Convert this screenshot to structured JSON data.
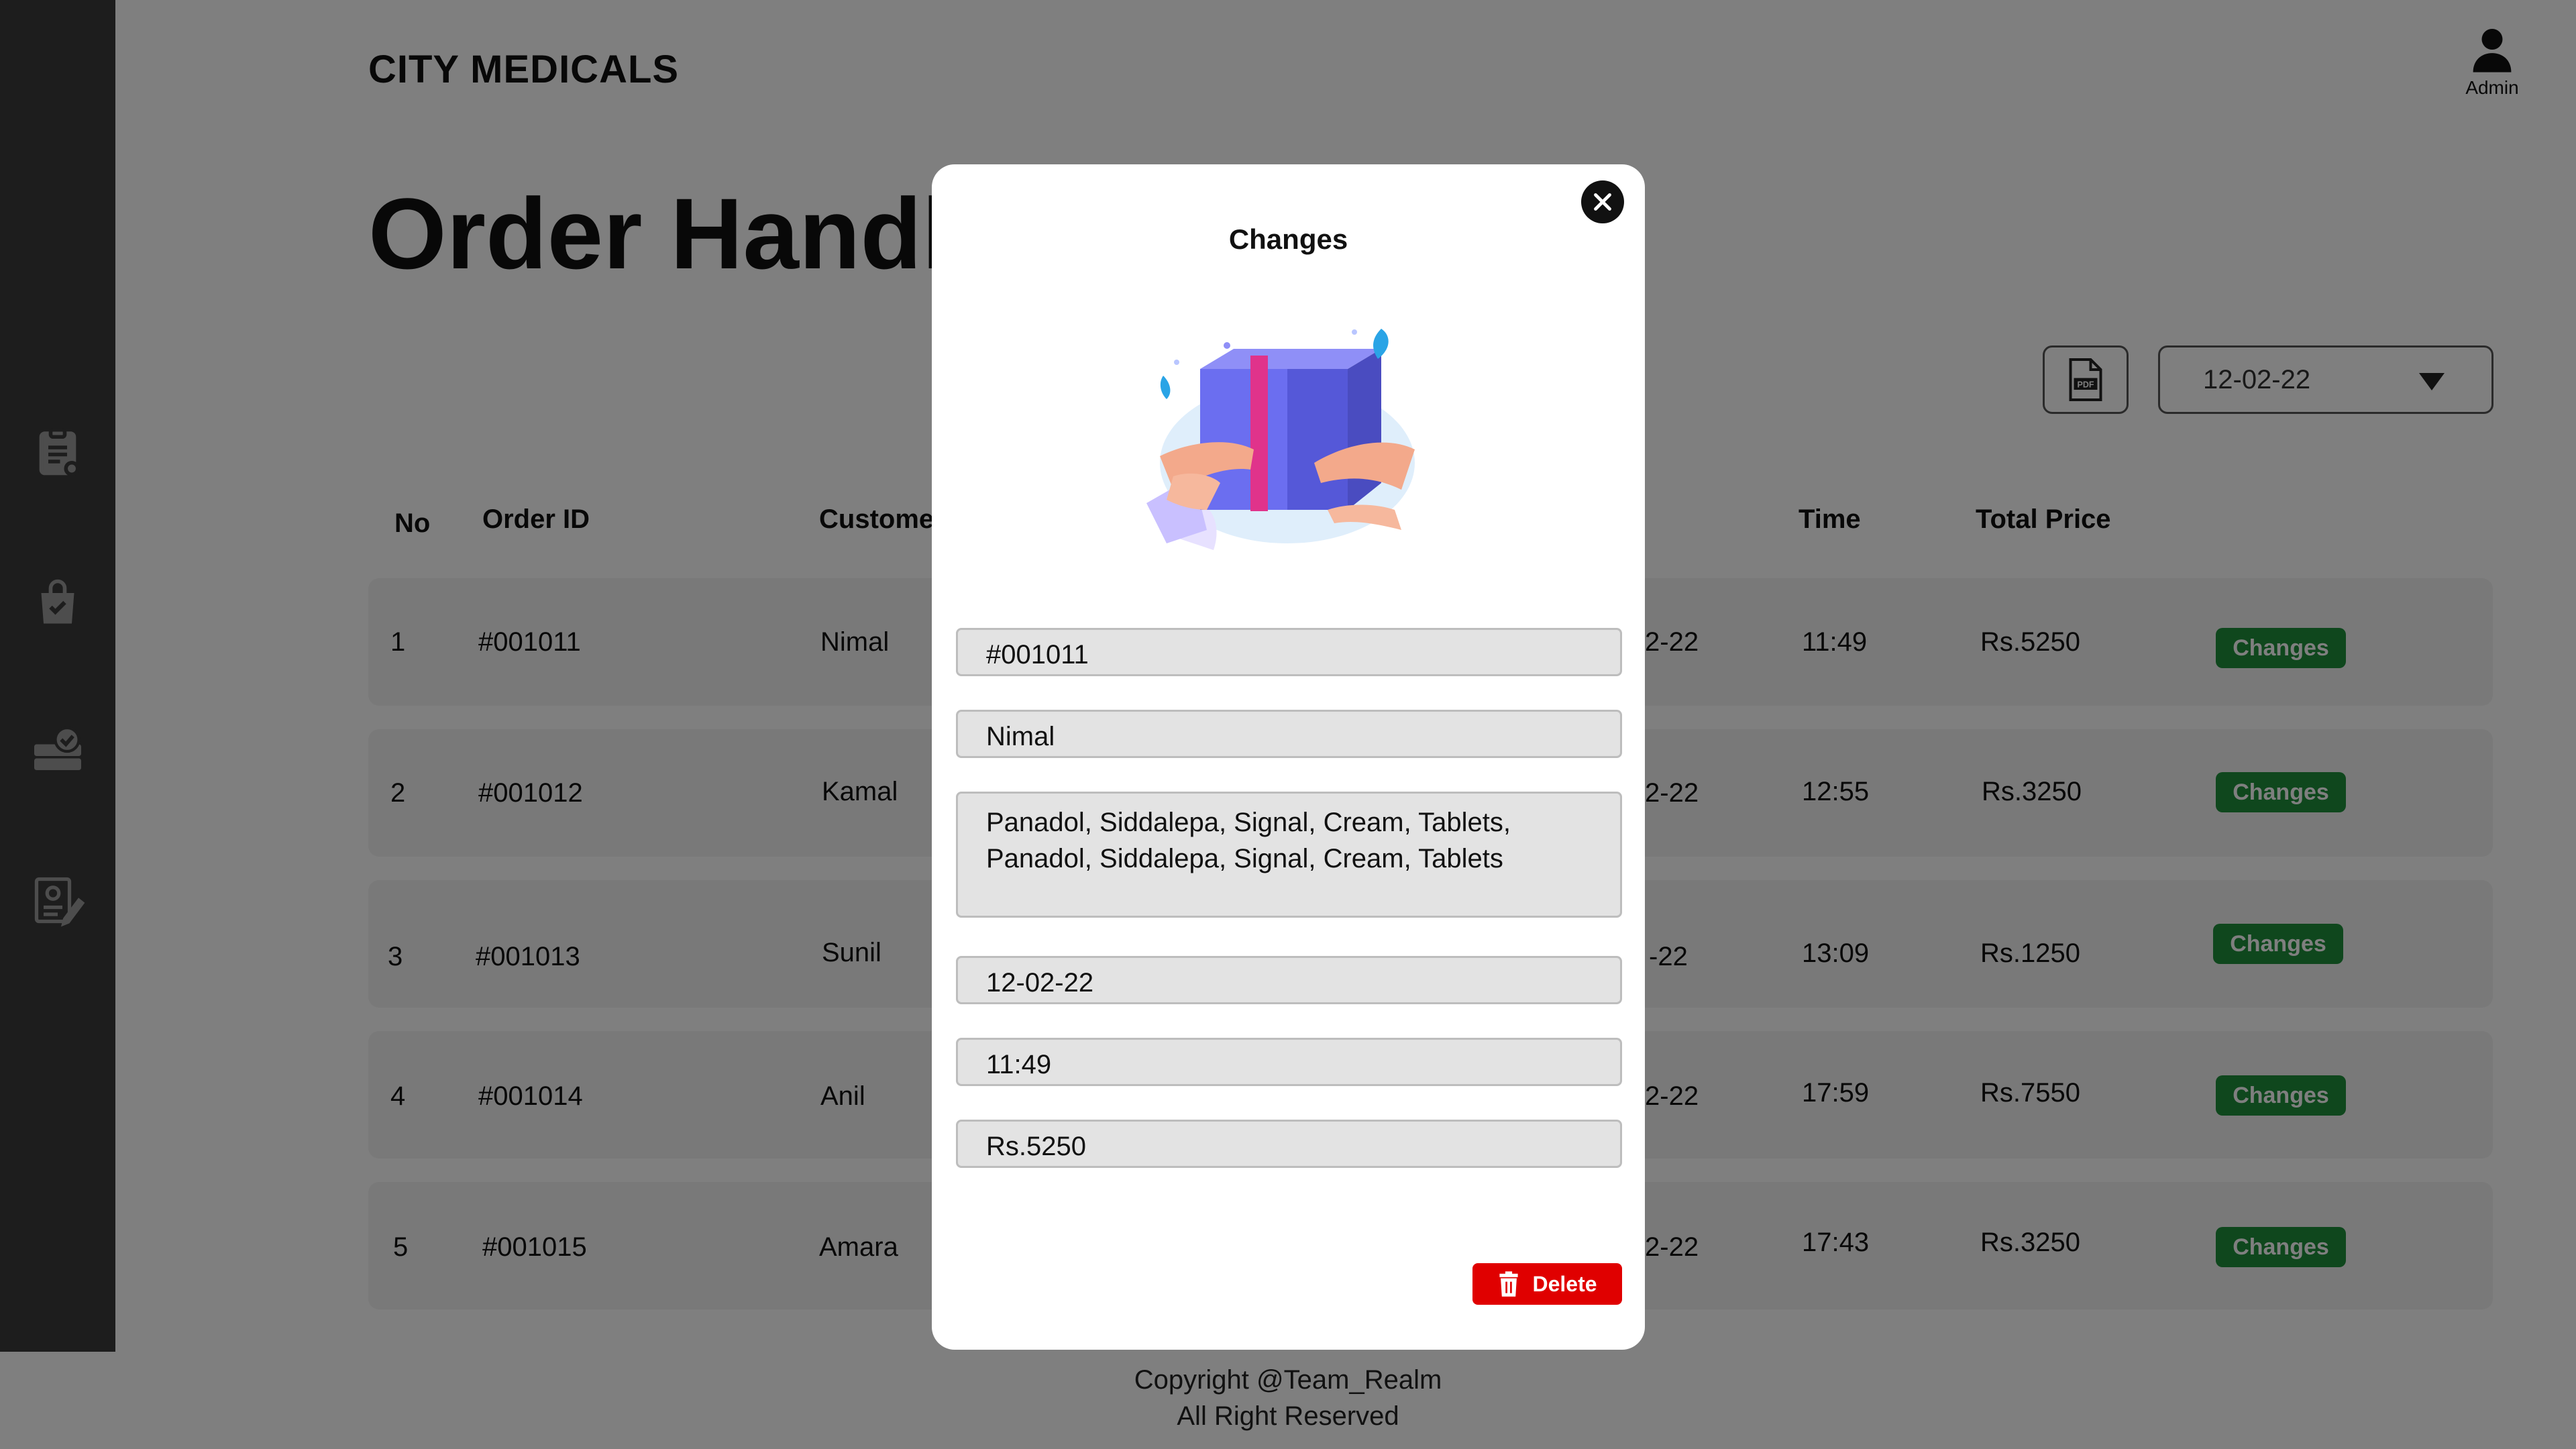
{
  "app": {
    "brand": "CITY MEDICALS",
    "user_label": "Admin"
  },
  "page": {
    "title": "Order Handling"
  },
  "toolbar": {
    "date_value": "12-02-22",
    "pdf_icon": "pdf-file-icon"
  },
  "sidebar": {
    "items": [
      {
        "icon": "clipboard-list-icon"
      },
      {
        "icon": "shopping-bag-check-icon"
      },
      {
        "icon": "delivery-truck-check-icon"
      },
      {
        "icon": "prescription-edit-icon"
      }
    ]
  },
  "table": {
    "headers": {
      "no": "No",
      "order_id": "Order ID",
      "customer": "Customer",
      "time": "Time",
      "total_price": "Total Price"
    },
    "rows": [
      {
        "no": "1",
        "order_id": "#001011",
        "customer": "Nimal",
        "date_tail": "2-22",
        "time": "11:49",
        "price": "Rs.5250",
        "action": "Changes"
      },
      {
        "no": "2",
        "order_id": "#001012",
        "customer": "Kamal",
        "date_tail": "2-22",
        "time": "12:55",
        "price": "Rs.3250",
        "action": "Changes"
      },
      {
        "no": "3",
        "order_id": "#001013",
        "customer": "Sunil",
        "date_tail": "-22",
        "time": "13:09",
        "price": "Rs.1250",
        "action": "Changes"
      },
      {
        "no": "4",
        "order_id": "#001014",
        "customer": "Anil",
        "date_tail": "2-22",
        "time": "17:59",
        "price": "Rs.7550",
        "action": "Changes"
      },
      {
        "no": "5",
        "order_id": "#001015",
        "customer": "Amara",
        "date_tail": "2-22",
        "time": "17:43",
        "price": "Rs.3250",
        "action": "Changes"
      }
    ]
  },
  "footer": {
    "line1": "Copyright @Team_Realm",
    "line2": "All Right Reserved"
  },
  "modal": {
    "title": "Changes",
    "illustration": "gift-box-hands-illustration",
    "fields": {
      "order_id": "#001011",
      "customer": "Nimal",
      "items": "Panadol, Siddalepa, Signal, Cream, Tablets, Panadol, Siddalepa, Signal, Cream, Tablets",
      "date": "12-02-22",
      "time": "11:49",
      "price": "Rs.5250"
    },
    "delete_label": "Delete"
  },
  "colors": {
    "sidebar": "#3a3a3a",
    "changes_button": "#1e8f3a",
    "delete_button": "#e00000",
    "overlay": "rgba(0,0,0,0.5)"
  }
}
